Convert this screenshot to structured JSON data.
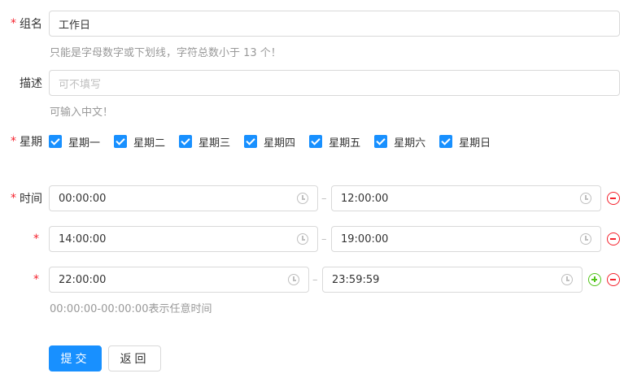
{
  "form": {
    "group_name": {
      "required_mark": "*",
      "label": "组名",
      "value": "工作日",
      "help": "只能是字母数字或下划线，字符总数小于 13 个！"
    },
    "description": {
      "label": "描述",
      "placeholder": "可不填写",
      "help": "可输入中文！"
    },
    "weekday": {
      "required_mark": "*",
      "label": "星期",
      "options": [
        {
          "label": "星期一",
          "checked": true
        },
        {
          "label": "星期二",
          "checked": true
        },
        {
          "label": "星期三",
          "checked": true
        },
        {
          "label": "星期四",
          "checked": true
        },
        {
          "label": "星期五",
          "checked": true
        },
        {
          "label": "星期六",
          "checked": true
        },
        {
          "label": "星期日",
          "checked": true
        }
      ]
    },
    "time": {
      "required_mark": "*",
      "label": "时间",
      "separator": "–",
      "ranges": [
        {
          "start": "00:00:00",
          "end": "12:00:00"
        },
        {
          "start": "14:00:00",
          "end": "19:00:00"
        },
        {
          "start": "22:00:00",
          "end": "23:59:59"
        }
      ],
      "help": "00:00:00-00:00:00表示任意时间"
    }
  },
  "actions": {
    "submit_label": "提交",
    "back_label": "返回"
  },
  "colors": {
    "primary": "#1890ff",
    "required": "#f5222d",
    "add": "#52c41a",
    "remove": "#f5222d"
  },
  "icons": {
    "time_field": "clock-icon",
    "add": "plus-circle-icon",
    "remove": "minus-circle-icon"
  }
}
